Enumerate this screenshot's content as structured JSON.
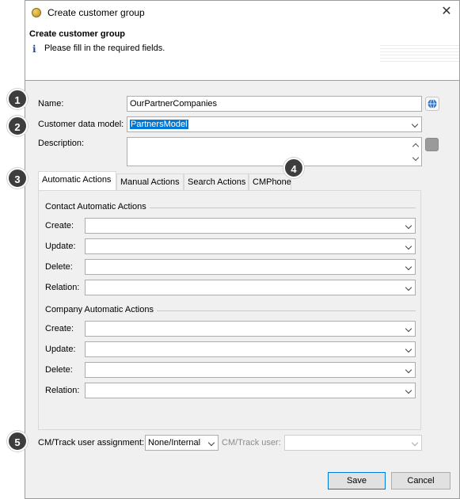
{
  "window": {
    "title": "Create customer group",
    "close_label": "✕"
  },
  "header": {
    "title": "Create customer group",
    "info_icon": "i",
    "message": "Please fill in the required fields."
  },
  "form": {
    "name_label": "Name:",
    "name_value": "OurPartnerCompanies",
    "model_label": "Customer data model:",
    "model_value": "PartnersModel",
    "description_label": "Description:",
    "description_value": ""
  },
  "tabs": [
    "Automatic Actions",
    "Manual Actions",
    "Search Actions",
    "CMPhone"
  ],
  "active_tab": "Automatic Actions",
  "contact_group": {
    "title": "Contact Automatic Actions",
    "rows": [
      {
        "label": "Create:",
        "value": ""
      },
      {
        "label": "Update:",
        "value": ""
      },
      {
        "label": "Delete:",
        "value": ""
      },
      {
        "label": "Relation:",
        "value": ""
      }
    ]
  },
  "company_group": {
    "title": "Company Automatic Actions",
    "rows": [
      {
        "label": "Create:",
        "value": ""
      },
      {
        "label": "Update:",
        "value": ""
      },
      {
        "label": "Delete:",
        "value": ""
      },
      {
        "label": "Relation:",
        "value": ""
      }
    ]
  },
  "assignment": {
    "label": "CM/Track user assignment:",
    "value": "None/Internal",
    "user_label": "CM/Track user:",
    "user_value": ""
  },
  "buttons": {
    "save": "Save",
    "cancel": "Cancel"
  },
  "callouts": [
    "1",
    "2",
    "3",
    "4",
    "5"
  ],
  "colors": {
    "selection": "#0078d7",
    "callout": "#3d3d3d",
    "default_button_border": "#0078d7"
  },
  "icons": [
    "app-icon",
    "close-icon",
    "info-icon",
    "globe-icon",
    "chevron-down-icon"
  ]
}
